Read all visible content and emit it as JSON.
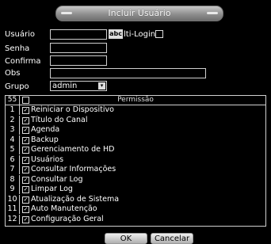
{
  "window": {
    "title": "Incluir Usuário"
  },
  "form": {
    "usuario_label": "Usuário",
    "senha_label": "Senha",
    "confirma_label": "Confirma",
    "obs_label": "Obs",
    "grupo_label": "Grupo",
    "keyboard_label": "abc",
    "multi_login_label": "lti-Login",
    "grupo_value": "admin",
    "grupo_arrow": "▾"
  },
  "permissions": {
    "count": "55",
    "header": "Permissão",
    "items": [
      {
        "n": "1",
        "label": "Reiniciar o Dispositivo"
      },
      {
        "n": "2",
        "label": "Título do Canal"
      },
      {
        "n": "3",
        "label": "Agenda"
      },
      {
        "n": "4",
        "label": "Backup"
      },
      {
        "n": "5",
        "label": "Gerenciamento de HD"
      },
      {
        "n": "6",
        "label": "Usuários"
      },
      {
        "n": "7",
        "label": "Consultar Informações"
      },
      {
        "n": "8",
        "label": "Consultar Log"
      },
      {
        "n": "9",
        "label": "Limpar Log"
      },
      {
        "n": "10",
        "label": "Atualização de Sistema"
      },
      {
        "n": "11",
        "label": "Auto Manutenção"
      },
      {
        "n": "12",
        "label": "Configuração Geral"
      }
    ],
    "check_glyph": "✓"
  },
  "buttons": {
    "ok": "OK",
    "cancel": "Cancelar"
  }
}
